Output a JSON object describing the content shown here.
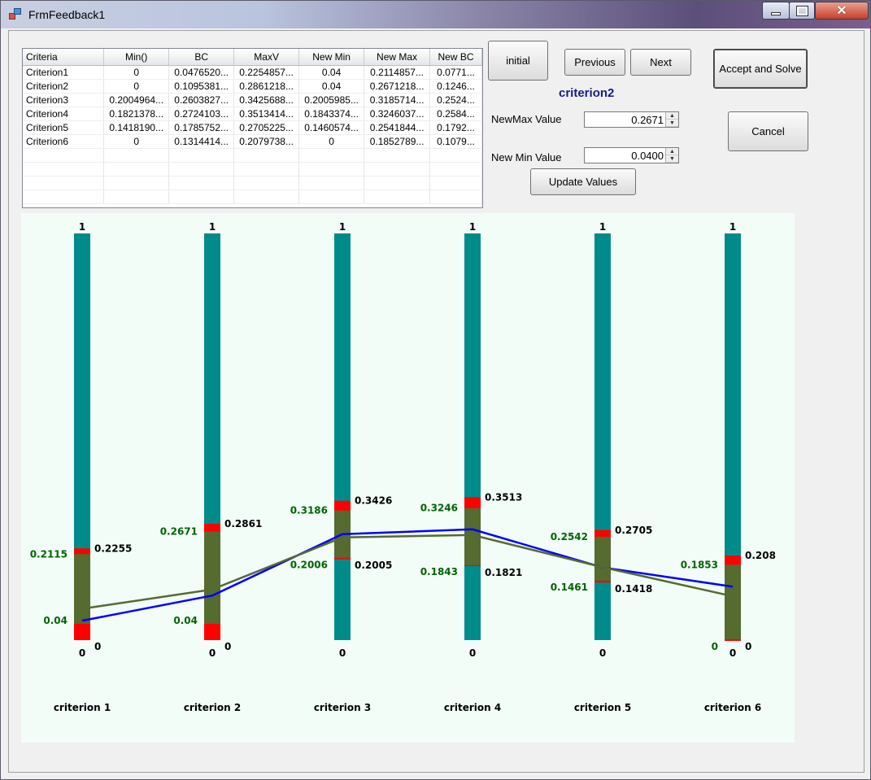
{
  "window": {
    "title": "FrmFeedback1"
  },
  "grid": {
    "columns": [
      "Criteria",
      "Min()",
      "BC",
      "MaxV",
      "New Min",
      "New Max",
      "New BC"
    ],
    "rows": [
      [
        "Criterion1",
        "0",
        "0.0476520...",
        "0.2254857...",
        "0.04",
        "0.2114857...",
        "0.0771..."
      ],
      [
        "Criterion2",
        "0",
        "0.1095381...",
        "0.2861218...",
        "0.04",
        "0.2671218...",
        "0.1246..."
      ],
      [
        "Criterion3",
        "0.2004964...",
        "0.2603827...",
        "0.3425688...",
        "0.2005985...",
        "0.3185714...",
        "0.2524..."
      ],
      [
        "Criterion4",
        "0.1821378...",
        "0.2724103...",
        "0.3513414...",
        "0.1843374...",
        "0.3246037...",
        "0.2584..."
      ],
      [
        "Criterion5",
        "0.1418190...",
        "0.1785752...",
        "0.2705225...",
        "0.1460574...",
        "0.2541844...",
        "0.1792..."
      ],
      [
        "Criterion6",
        "0",
        "0.1314414...",
        "0.2079738...",
        "0",
        "0.1852789...",
        "0.1079..."
      ]
    ]
  },
  "buttons": {
    "initial": "initial",
    "previous": "Previous",
    "next": "Next",
    "accept": "Accept and Solve",
    "cancel": "Cancel",
    "update": "Update Values"
  },
  "selected_criterion": "criterion2",
  "newmax": {
    "label": "NewMax Value",
    "value": "0.2671"
  },
  "newmin": {
    "label": "New Min Value",
    "value": "0.0400"
  },
  "colors": {
    "bar": "#008b8b",
    "range": "#556b2f",
    "limit": "#ff0000",
    "line_bc": "#0000ff",
    "line_newbc": "#556b2f",
    "green_text": "#006400"
  },
  "chart_data": {
    "type": "parallel-range",
    "ylim": [
      0,
      1
    ],
    "criteria": [
      {
        "name": "criterion 1",
        "top_label": "1",
        "bottom_label": "0",
        "min": 0,
        "max": 0.2255,
        "new_min": 0.04,
        "new_max": 0.2115,
        "bc": 0.0477,
        "new_bc": 0.0771,
        "max_label": "0.2255",
        "min_label": "0",
        "new_max_label": "0.2115",
        "new_min_label": "0.04"
      },
      {
        "name": "criterion 2",
        "top_label": "1",
        "bottom_label": "0",
        "min": 0,
        "max": 0.2861,
        "new_min": 0.04,
        "new_max": 0.2671,
        "bc": 0.1095,
        "new_bc": 0.1246,
        "max_label": "0.2861",
        "min_label": "0",
        "new_max_label": "0.2671",
        "new_min_label": "0.04"
      },
      {
        "name": "criterion 3",
        "top_label": "1",
        "bottom_label": "0",
        "min": 0.2005,
        "max": 0.3426,
        "new_min": 0.2006,
        "new_max": 0.3186,
        "bc": 0.2604,
        "new_bc": 0.2524,
        "max_label": "0.3426",
        "min_label": "0.2005",
        "new_max_label": "0.3186",
        "new_min_label": "0.2006"
      },
      {
        "name": "criterion 4",
        "top_label": "1",
        "bottom_label": "0",
        "min": 0.1821,
        "max": 0.3513,
        "new_min": 0.1843,
        "new_max": 0.3246,
        "bc": 0.2724,
        "new_bc": 0.2584,
        "max_label": "0.3513",
        "min_label": "0.1821",
        "new_max_label": "0.3246",
        "new_min_label": "0.1843"
      },
      {
        "name": "criterion 5",
        "top_label": "1",
        "bottom_label": "0",
        "min": 0.1418,
        "max": 0.2705,
        "new_min": 0.1461,
        "new_max": 0.2542,
        "bc": 0.1786,
        "new_bc": 0.1792,
        "max_label": "0.2705",
        "min_label": "0.1418",
        "new_max_label": "0.2542",
        "new_min_label": "0.1461"
      },
      {
        "name": "criterion 6",
        "top_label": "1",
        "bottom_label": "0",
        "min": 0,
        "max": 0.208,
        "new_min": 0,
        "new_max": 0.1853,
        "bc": 0.1314,
        "new_bc": 0.1079,
        "max_label": "0.208",
        "min_label": "0",
        "new_max_label": "0.1853",
        "new_min_label": "0"
      }
    ]
  }
}
